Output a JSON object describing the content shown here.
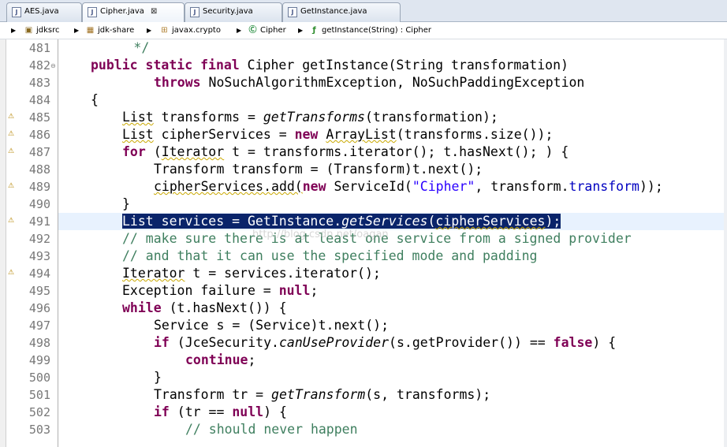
{
  "tabs": [
    {
      "name": "tab-aes",
      "label": "AES.java",
      "active": false
    },
    {
      "name": "tab-cipher",
      "label": "Cipher.java",
      "active": true,
      "close": "⊠"
    },
    {
      "name": "tab-security",
      "label": "Security.java",
      "active": false
    },
    {
      "name": "tab-getinstance",
      "label": "GetInstance.java",
      "active": false
    }
  ],
  "breadcrumb": {
    "items": [
      "jdksrc",
      "jdk-share",
      "javax.crypto",
      "Cipher",
      "getInstance(String) : Cipher"
    ]
  },
  "watermark": "http://blog.csdn.net/oagan",
  "lines": [
    {
      "n": "481"
    },
    {
      "n": "482"
    },
    {
      "n": "483"
    },
    {
      "n": "484"
    },
    {
      "n": "485"
    },
    {
      "n": "486"
    },
    {
      "n": "487"
    },
    {
      "n": "488"
    },
    {
      "n": "489"
    },
    {
      "n": "490"
    },
    {
      "n": "491"
    },
    {
      "n": "492"
    },
    {
      "n": "493"
    },
    {
      "n": "494"
    },
    {
      "n": "495"
    },
    {
      "n": "496"
    },
    {
      "n": "497"
    },
    {
      "n": "498"
    },
    {
      "n": "499"
    },
    {
      "n": "500"
    },
    {
      "n": "501"
    },
    {
      "n": "502"
    },
    {
      "n": "503"
    }
  ],
  "code": {
    "l481": {
      "t1": "         */"
    },
    "l482": {
      "k1": "public static final",
      "t1": " Cipher getInstance(String transformation)"
    },
    "l483": {
      "k1": "throws",
      "t1": " NoSuchAlgorithmException, NoSuchPaddingException"
    },
    "l484": {
      "t1": "{"
    },
    "l485": {
      "t1": "List",
      "t2": " transforms = ",
      "i1": "getTransforms",
      "t3": "(transformation);"
    },
    "l486": {
      "t1": "List",
      "t2": " cipherServices = ",
      "k1": "new",
      "t3": " ",
      "t4": "ArrayList",
      "t5": "(transforms.size());"
    },
    "l487": {
      "k1": "for",
      "t1": " (",
      "t2": "Iterator",
      "t3": " t = transforms.iterator(); t.hasNext(); ) {"
    },
    "l488": {
      "t1": "Transform transform = (Transform)t.next();"
    },
    "l489": {
      "t1": "cipherServices.add(",
      "k1": "new",
      "t2": " ServiceId(",
      "s1": "\"Cipher\"",
      "t3": ", transform.",
      "f1": "transform",
      "t4": "));"
    },
    "l490": {
      "t1": "}"
    },
    "l491": {
      "t1": "List",
      "t2": " services = GetInstance.",
      "i1": "getServices",
      "t3": "(",
      "t4": "cipherServices",
      "t5": ");"
    },
    "l492": {
      "c1": "// make sure there is at least one service from a signed provider"
    },
    "l493": {
      "c1": "// and that it can use the specified mode and padding"
    },
    "l494": {
      "t1": "Iterator",
      "t2": " t = services.iterator();"
    },
    "l495": {
      "t1": "Exception failure = ",
      "k1": "null",
      "t2": ";"
    },
    "l496": {
      "k1": "while",
      "t1": " (t.hasNext()) {"
    },
    "l497": {
      "t1": "Service s = (Service)t.next();"
    },
    "l498": {
      "k1": "if",
      "t1": " (JceSecurity.",
      "i1": "canUseProvider",
      "t2": "(s.getProvider()) == ",
      "k2": "false",
      "t3": ") {"
    },
    "l499": {
      "k1": "continue",
      "t1": ";"
    },
    "l500": {
      "t1": "}"
    },
    "l501": {
      "t1": "Transform tr = ",
      "i1": "getTransform",
      "t2": "(s, transforms);"
    },
    "l502": {
      "k1": "if",
      "t1": " (tr == ",
      "k2": "null",
      "t2": ") {"
    },
    "l503": {
      "c1": "// should never happen"
    }
  }
}
